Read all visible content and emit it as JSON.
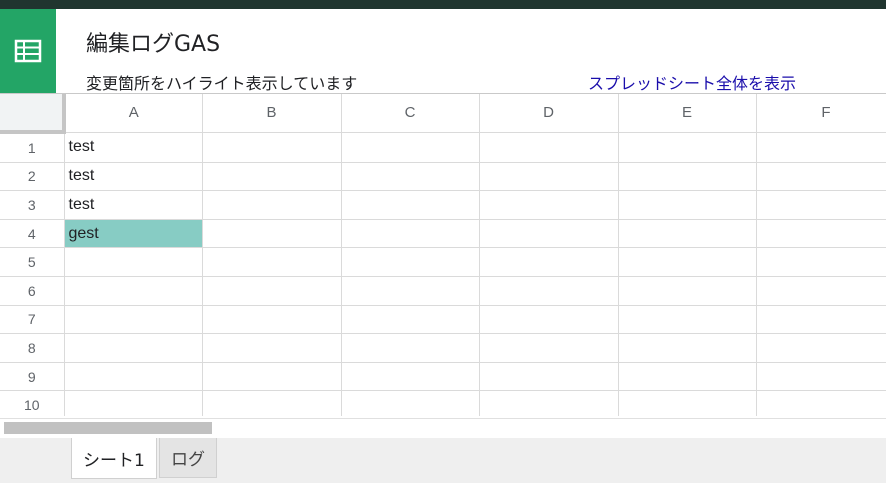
{
  "app": {
    "title": "編集ログGAS",
    "subtitle": "変更箇所をハイライト表示しています",
    "open_link": "スプレッドシート全体を表示"
  },
  "grid": {
    "columns": [
      "A",
      "B",
      "C",
      "D",
      "E",
      "F"
    ],
    "rows": [
      {
        "num": "1",
        "cells": [
          "test",
          "",
          "",
          "",
          "",
          ""
        ]
      },
      {
        "num": "2",
        "cells": [
          "test",
          "",
          "",
          "",
          "",
          ""
        ]
      },
      {
        "num": "3",
        "cells": [
          "test",
          "",
          "",
          "",
          "",
          ""
        ]
      },
      {
        "num": "4",
        "cells": [
          "gest",
          "",
          "",
          "",
          "",
          ""
        ]
      },
      {
        "num": "5",
        "cells": [
          "",
          "",
          "",
          "",
          "",
          ""
        ]
      },
      {
        "num": "6",
        "cells": [
          "",
          "",
          "",
          "",
          "",
          ""
        ]
      },
      {
        "num": "7",
        "cells": [
          "",
          "",
          "",
          "",
          "",
          ""
        ]
      },
      {
        "num": "8",
        "cells": [
          "",
          "",
          "",
          "",
          "",
          ""
        ]
      },
      {
        "num": "9",
        "cells": [
          "",
          "",
          "",
          "",
          "",
          ""
        ]
      },
      {
        "num": "10",
        "cells": [
          "",
          "",
          "",
          "",
          "",
          ""
        ]
      }
    ],
    "highlight_color": "#87ccc4"
  },
  "tabs": [
    {
      "label": "シート1",
      "active": true
    },
    {
      "label": "ログ",
      "active": false
    }
  ],
  "colors": {
    "brand": "#23a566",
    "link": "#1a0dab"
  },
  "icons": {
    "app": "spreadsheet-icon"
  }
}
